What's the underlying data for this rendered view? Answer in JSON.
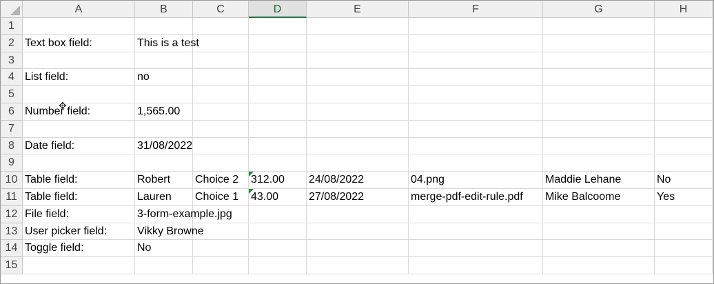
{
  "sheet": {
    "columns": [
      "A",
      "B",
      "C",
      "D",
      "E",
      "F",
      "G",
      "H"
    ],
    "selected_column": "D",
    "rows": [
      {
        "n": "1",
        "cells": [
          "",
          "",
          "",
          "",
          "",
          "",
          "",
          ""
        ]
      },
      {
        "n": "2",
        "cells": [
          "Text box field:",
          "This is a test",
          "",
          "",
          "",
          "",
          "",
          ""
        ]
      },
      {
        "n": "3",
        "cells": [
          "",
          "",
          "",
          "",
          "",
          "",
          "",
          ""
        ]
      },
      {
        "n": "4",
        "cells": [
          "List field:",
          "no",
          "",
          "",
          "",
          "",
          "",
          ""
        ]
      },
      {
        "n": "5",
        "cells": [
          "",
          "",
          "",
          "",
          "",
          "",
          "",
          ""
        ]
      },
      {
        "n": "6",
        "cells": [
          "Number field:",
          "1,565.00",
          "",
          "",
          "",
          "",
          "",
          ""
        ]
      },
      {
        "n": "7",
        "cells": [
          "",
          "",
          "",
          "",
          "",
          "",
          "",
          ""
        ]
      },
      {
        "n": "8",
        "cells": [
          "Date field:",
          "31/08/2022",
          "",
          "",
          "",
          "",
          "",
          ""
        ]
      },
      {
        "n": "9",
        "cells": [
          "",
          "",
          "",
          "",
          "",
          "",
          "",
          ""
        ]
      },
      {
        "n": "10",
        "cells": [
          "Table field:",
          "Robert",
          "Choice 2",
          "312.00",
          "24/08/2022",
          "04.png",
          "Maddie Lehane",
          "No"
        ]
      },
      {
        "n": "11",
        "cells": [
          "Table field:",
          "Lauren",
          "Choice 1",
          "43.00",
          "27/08/2022",
          "merge-pdf-edit-rule.pdf",
          "Mike Balcoome",
          "Yes"
        ]
      },
      {
        "n": "12",
        "cells": [
          "File field:",
          "3-form-example.jpg",
          "",
          "",
          "",
          "",
          "",
          ""
        ]
      },
      {
        "n": "13",
        "cells": [
          "User picker field:",
          "Vikky Browne",
          "",
          "",
          "",
          "",
          "",
          ""
        ]
      },
      {
        "n": "14",
        "cells": [
          "Toggle field:",
          "No",
          "",
          "",
          "",
          "",
          "",
          ""
        ]
      },
      {
        "n": "15",
        "cells": [
          "",
          "",
          "",
          "",
          "",
          "",
          "",
          ""
        ]
      }
    ],
    "number_stored_as_text_cells": [
      "D10",
      "D11"
    ]
  },
  "colors": {
    "header_bg": "#f0f0f0",
    "selected_header_accent": "#217346",
    "gridline": "#d9d9d9",
    "error_indicator": "#1f8a3a"
  },
  "pointer": {
    "icon": "cell-select-cross-cursor-icon",
    "glyph": "✥"
  }
}
